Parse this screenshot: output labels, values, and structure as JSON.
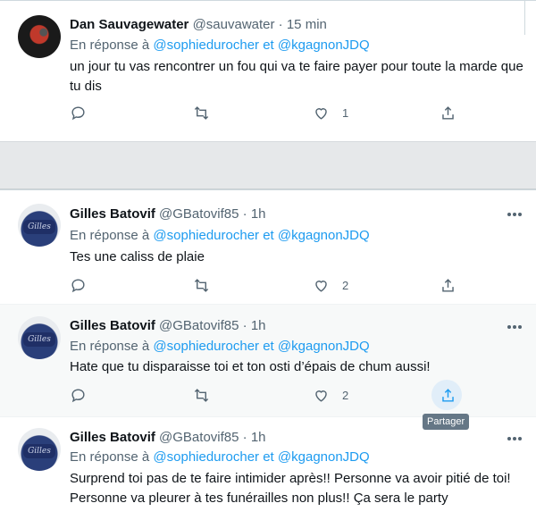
{
  "tweets": [
    {
      "name": "Dan Sauvagewater",
      "handle": "@sauvawater",
      "time": "15 min",
      "reply_prefix": "En réponse à",
      "mention1": "@sophiedurocher",
      "joiner": "et",
      "mention2": "@kgagnonJDQ",
      "text": "un jour tu vas rencontrer un fou qui va te faire payer pour toute la marde que tu dis",
      "likes": "1",
      "avatar": "dark-red-avatar"
    },
    {
      "name": "Gilles Batovif",
      "handle": "@GBatovif85",
      "time": "1h",
      "reply_prefix": "En réponse à",
      "mention1": "@sophiedurocher",
      "joiner": "et",
      "mention2": "@kgagnonJDQ",
      "text": "Tes une caliss de plaie",
      "likes": "2",
      "avatar": "blue-cap-avatar"
    },
    {
      "name": "Gilles Batovif",
      "handle": "@GBatovif85",
      "time": "1h",
      "reply_prefix": "En réponse à",
      "mention1": "@sophiedurocher",
      "joiner": "et",
      "mention2": "@kgagnonJDQ",
      "text": "Hate que tu disparaisse toi et ton osti d’épais de chum aussi!",
      "likes": "2",
      "avatar": "blue-cap-avatar"
    },
    {
      "name": "Gilles Batovif",
      "handle": "@GBatovif85",
      "time": "1h",
      "reply_prefix": "En réponse à",
      "mention1": "@sophiedurocher",
      "joiner": "et",
      "mention2": "@kgagnonJDQ",
      "text": "Surprend toi pas de te faire intimider après!! Personne va avoir pitié de toi! Personne va pleurer à tes funérailles non plus!! Ça sera le party",
      "avatar": "blue-cap-avatar"
    }
  ],
  "separator": "·",
  "tooltip": "Partager",
  "colors": {
    "link": "#1d9bf0",
    "muted": "#536471",
    "hover_bg": "#f7f9f9"
  }
}
